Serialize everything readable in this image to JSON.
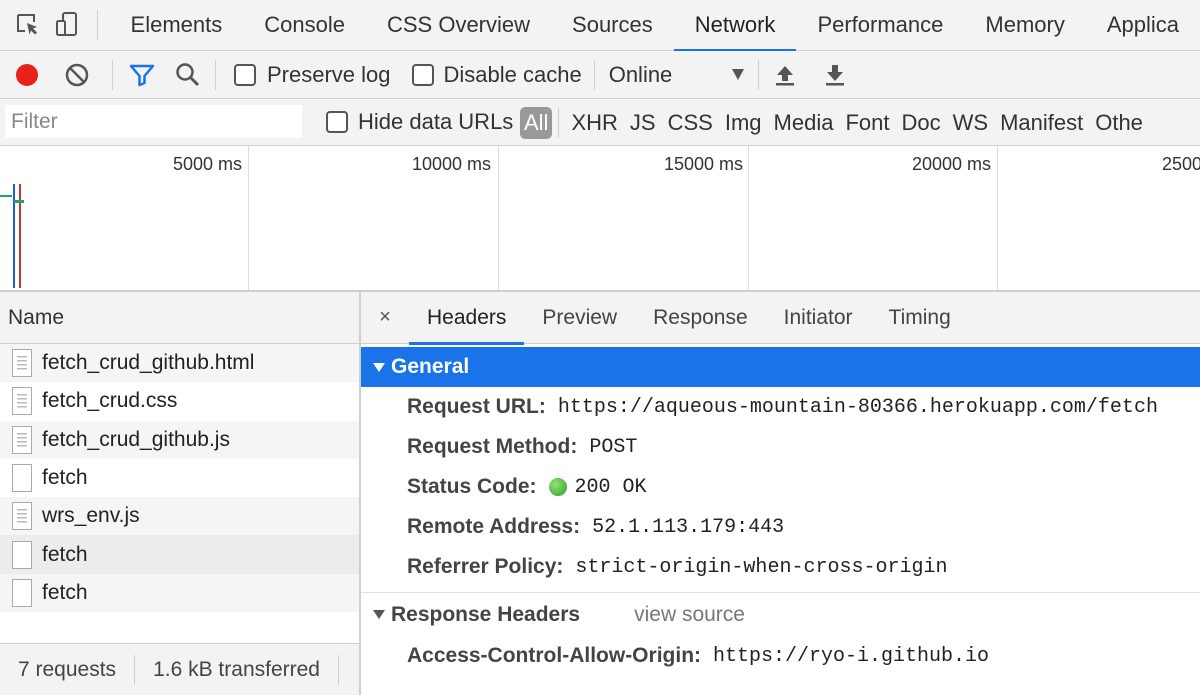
{
  "tabs": [
    "Elements",
    "Console",
    "CSS Overview",
    "Sources",
    "Network",
    "Performance",
    "Memory",
    "Applica"
  ],
  "active_tab": "Network",
  "toolbar": {
    "preserve_log": "Preserve log",
    "disable_cache": "Disable cache",
    "throttle": "Online"
  },
  "filter": {
    "placeholder": "Filter",
    "hide_data_urls": "Hide data URLs",
    "types": [
      "All",
      "XHR",
      "JS",
      "CSS",
      "Img",
      "Media",
      "Font",
      "Doc",
      "WS",
      "Manifest",
      "Othe"
    ]
  },
  "overview": {
    "ticks": [
      "5000 ms",
      "10000 ms",
      "15000 ms",
      "20000 ms",
      "2500"
    ]
  },
  "requests": {
    "header": "Name",
    "items": [
      {
        "name": "fetch_crud_github.html",
        "icon": "document-icon"
      },
      {
        "name": "fetch_crud.css",
        "icon": "document-icon"
      },
      {
        "name": "fetch_crud_github.js",
        "icon": "document-icon"
      },
      {
        "name": "fetch",
        "icon": "blank-file-icon"
      },
      {
        "name": "wrs_env.js",
        "icon": "document-icon"
      },
      {
        "name": "fetch",
        "icon": "blank-file-icon"
      },
      {
        "name": "fetch",
        "icon": "blank-file-icon"
      }
    ],
    "summary": {
      "count": "7 requests",
      "transferred": "1.6 kB transferred"
    }
  },
  "detail": {
    "close": "×",
    "tabs": [
      "Headers",
      "Preview",
      "Response",
      "Initiator",
      "Timing"
    ],
    "active_tab": "Headers",
    "general": {
      "title": "General",
      "rows": [
        {
          "key": "Request URL:",
          "value": "https://aqueous-mountain-80366.herokuapp.com/fetch"
        },
        {
          "key": "Request Method:",
          "value": "POST"
        },
        {
          "key": "Status Code:",
          "value": "200 OK"
        },
        {
          "key": "Remote Address:",
          "value": "52.1.113.179:443"
        },
        {
          "key": "Referrer Policy:",
          "value": "strict-origin-when-cross-origin"
        }
      ]
    },
    "response_headers": {
      "title": "Response Headers",
      "view_source": "view source",
      "rows": [
        {
          "key": "Access-Control-Allow-Origin:",
          "value": "https://ryo-i.github.io"
        }
      ]
    }
  },
  "colors": {
    "accent": "#1a73e8",
    "record": "#e8211c",
    "filter_icon": "#1a73e8",
    "status_ok": "#2ca21a"
  }
}
